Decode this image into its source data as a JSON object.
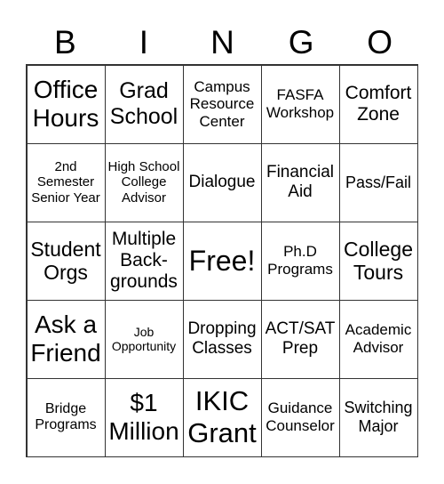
{
  "header": [
    "B",
    "I",
    "N",
    "G",
    "O"
  ],
  "cells": [
    "Office Hours",
    "Grad School",
    "Campus Resource Center",
    "FASFA Workshop",
    "Comfort Zone",
    "2nd Semester Senior Year",
    "High School College Advisor",
    "Dialogue",
    "Financial Aid",
    "Pass/Fail",
    "Student Orgs",
    "Multiple Back-grounds",
    "Free!",
    "Ph.D Programs",
    "College Tours",
    "Ask a Friend",
    "Job Opportunity",
    "Dropping Classes",
    "ACT/SAT Prep",
    "Academic Advisor",
    "Bridge Programs",
    "$1 Million",
    "IKIC Grant",
    "Guidance Counselor",
    "Switching Major"
  ]
}
